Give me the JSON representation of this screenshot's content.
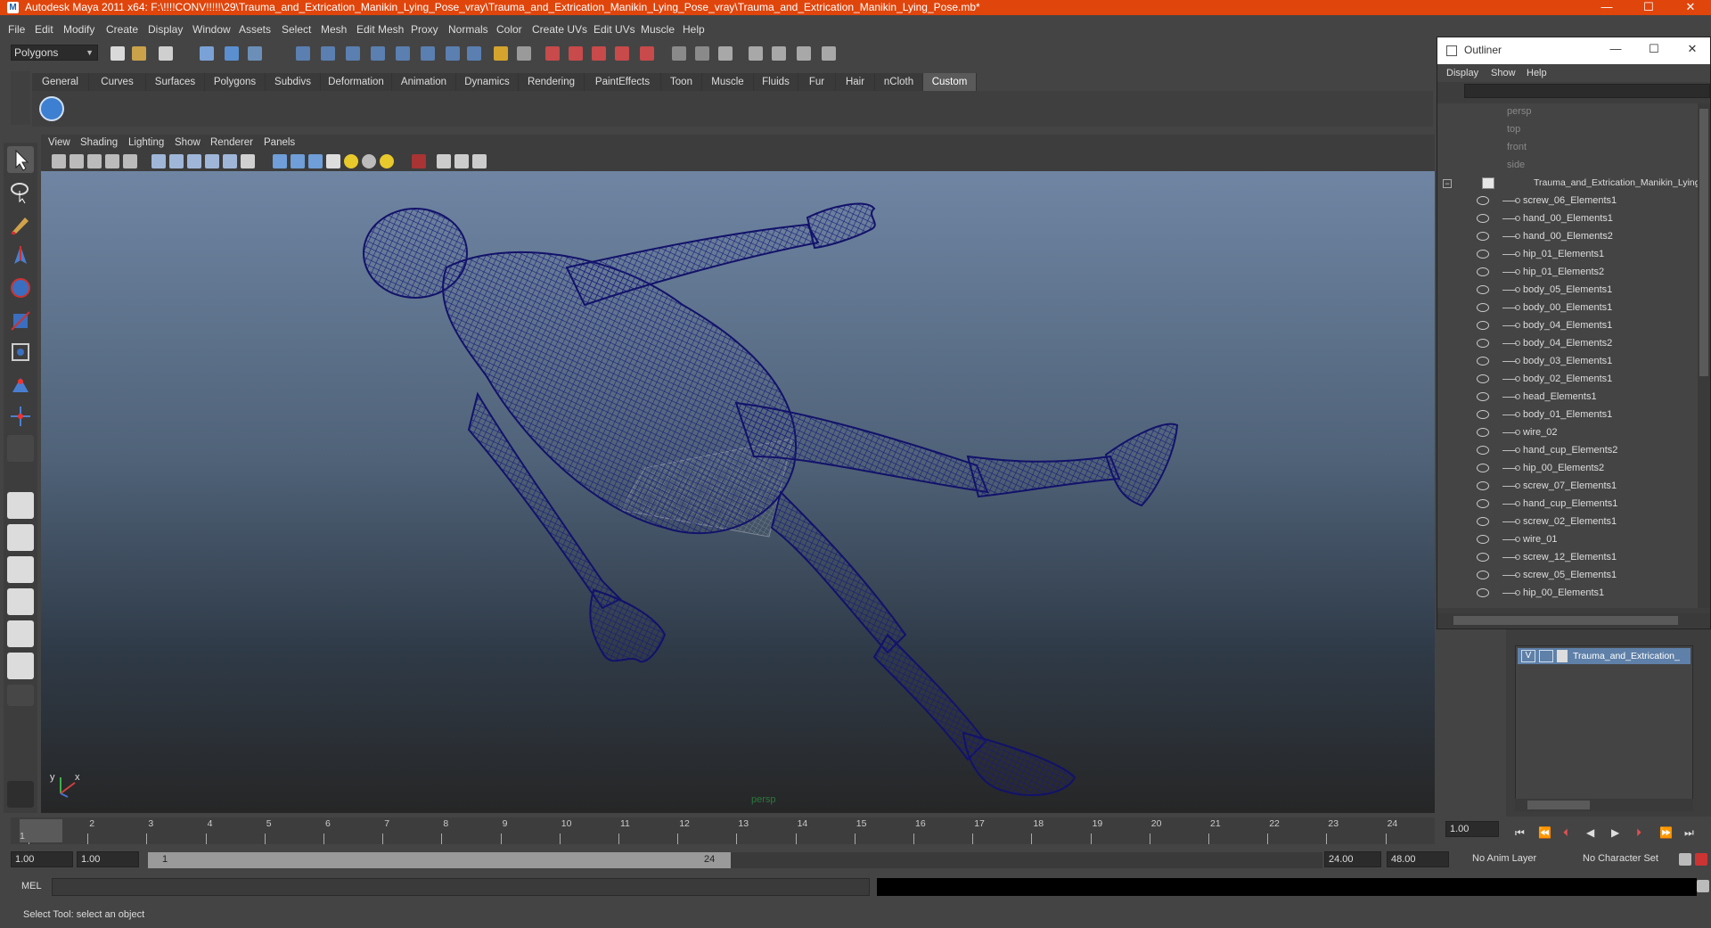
{
  "window": {
    "title": "Autodesk Maya 2011 x64: F:\\!!!!CONV!!!!!\\29\\Trauma_and_Extrication_Manikin_Lying_Pose_vray\\Trauma_and_Extrication_Manikin_Lying_Pose_vray\\Trauma_and_Extrication_Manikin_Lying_Pose.mb*",
    "controls": {
      "minimize": "—",
      "maximize": "☐",
      "close": "✕"
    }
  },
  "menubar": [
    "File",
    "Edit",
    "Modify",
    "Create",
    "Display",
    "Window",
    "Assets",
    "Select",
    "Mesh",
    "Edit Mesh",
    "Proxy",
    "Normals",
    "Color",
    "Create UVs",
    "Edit UVs",
    "Muscle",
    "Help"
  ],
  "statusline": {
    "mode": "Polygons"
  },
  "shelf": {
    "tabs": [
      "General",
      "Curves",
      "Surfaces",
      "Polygons",
      "Subdivs",
      "Deformation",
      "Animation",
      "Dynamics",
      "Rendering",
      "PaintEffects",
      "Toon",
      "Muscle",
      "Fluids",
      "Fur",
      "Hair",
      "nCloth",
      "Custom"
    ],
    "active": "Custom"
  },
  "viewport": {
    "menu": [
      "View",
      "Shading",
      "Lighting",
      "Show",
      "Renderer",
      "Panels"
    ],
    "camera": "persp",
    "axis": {
      "x": "x",
      "y": "y"
    }
  },
  "timeline": {
    "ticks": [
      "1",
      "2",
      "3",
      "4",
      "5",
      "6",
      "7",
      "8",
      "9",
      "10",
      "11",
      "12",
      "13",
      "14",
      "15",
      "16",
      "17",
      "18",
      "19",
      "20",
      "21",
      "22",
      "23",
      "24"
    ],
    "current_frame": "1",
    "current_time_field": "1.00"
  },
  "range": {
    "start": "1.00",
    "playback_start": "1.00",
    "slider_start": "1",
    "slider_end": "24",
    "playback_end": "24.00",
    "end": "48.00",
    "anim_layer": "No Anim Layer",
    "character_set": "No Character Set"
  },
  "cmdline": {
    "label": "MEL"
  },
  "helpline": {
    "text": "Select Tool: select an object"
  },
  "outliner": {
    "title": "Outliner",
    "menu": [
      "Display",
      "Show",
      "Help"
    ],
    "cameras": [
      "persp",
      "top",
      "front",
      "side"
    ],
    "group": "Trauma_and_Extrication_Manikin_Lying_Pose",
    "items": [
      "screw_06_Elements1",
      "hand_00_Elements1",
      "hand_00_Elements2",
      "hip_01_Elements1",
      "hip_01_Elements2",
      "body_05_Elements1",
      "body_00_Elements1",
      "body_04_Elements1",
      "body_04_Elements2",
      "body_03_Elements1",
      "body_02_Elements1",
      "head_Elements1",
      "body_01_Elements1",
      "wire_02",
      "hand_cup_Elements2",
      "hip_00_Elements2",
      "screw_07_Elements1",
      "hand_cup_Elements1",
      "screw_02_Elements1",
      "wire_01",
      "screw_12_Elements1",
      "screw_05_Elements1",
      "hip_00_Elements1"
    ]
  },
  "layers": {
    "visible_flag": "V",
    "layer_name": "Trauma_and_Extrication_"
  },
  "colors": {
    "titlebar": "#e0450c",
    "wireframe": "#1a1a7a",
    "layer_highlight": "#5f80a8"
  }
}
